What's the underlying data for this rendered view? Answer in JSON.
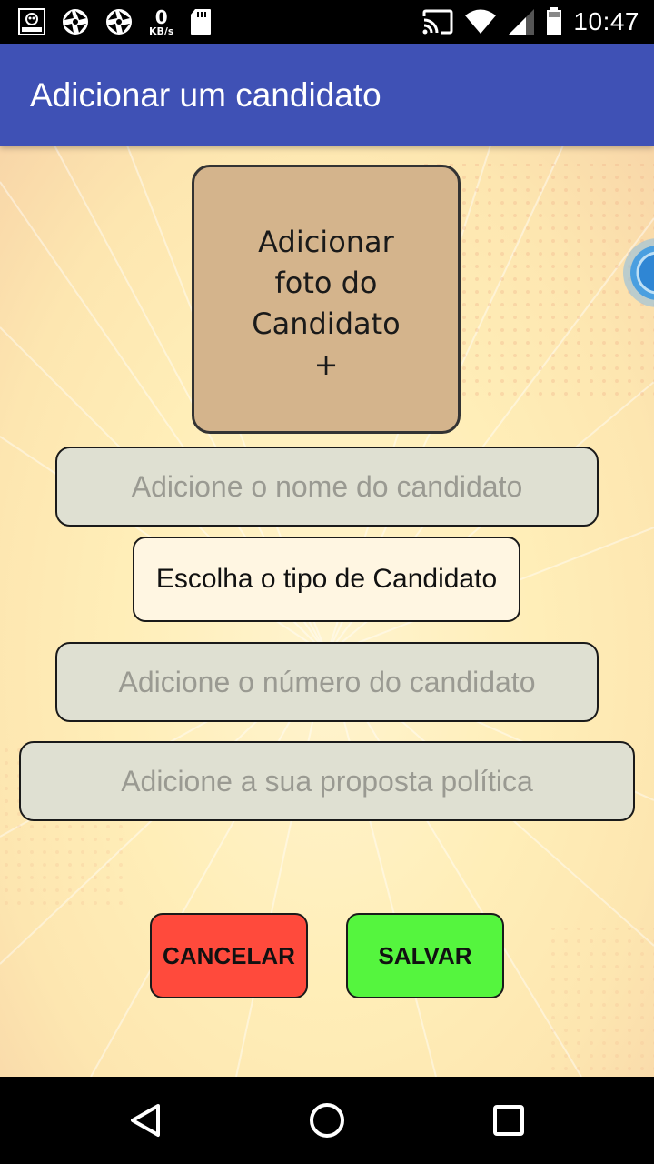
{
  "status_bar": {
    "data_speed_value": "0",
    "data_speed_unit": "KB/s",
    "time": "10:47",
    "icons": [
      "otaku-app-icon",
      "camera-shutter-icon",
      "camera-shutter-icon",
      "sd-card-icon",
      "cast-icon",
      "wifi-icon",
      "cell-signal-icon",
      "battery-icon"
    ]
  },
  "app_bar": {
    "title": "Adicionar um candidato",
    "color": "#3f51b5"
  },
  "form": {
    "photo_button_label": "Adicionar\nfoto do\nCandidato\n+",
    "name_placeholder": "Adicione o nome do candidato",
    "type_selector_label": "Escolha o tipo de Candidato",
    "number_placeholder": "Adicione o número do candidato",
    "proposal_placeholder": "Adicione a sua proposta política"
  },
  "buttons": {
    "cancel_label": "CANCELAR",
    "cancel_color": "#ff4a3c",
    "save_label": "SALVAR",
    "save_color": "#55f53e"
  },
  "nav_bar": {
    "icons": [
      "back-icon",
      "home-icon",
      "recents-icon"
    ]
  }
}
